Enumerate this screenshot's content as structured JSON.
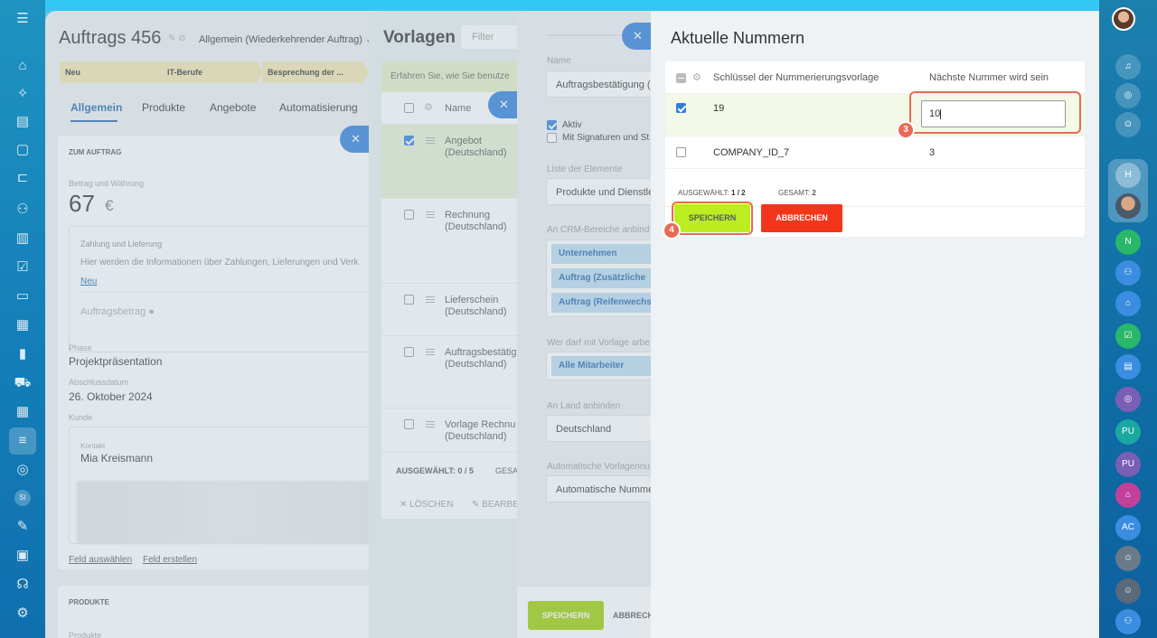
{
  "deal": {
    "title": "Auftrags 456",
    "type": "Allgemein (Wiederkehrender Auftrag)",
    "stages": [
      "Neu",
      "IT-Berufe",
      "Besprechung der ..."
    ],
    "tabs": [
      "Allgemein",
      "Produkte",
      "Angebote",
      "Automatisierung"
    ],
    "section_order": "ZUM AUFTRAG",
    "amount_label": "Betrag und Währung",
    "amount_value": "67",
    "currency": "€",
    "payment_label": "Zahlung und Lieferung",
    "payment_text": "Hier werden die Informationen über Zahlungen, Lieferungen und Verk",
    "payment_link": "Neu",
    "order_amount_label": "Auftragsbetrag",
    "phase_label": "Phase",
    "phase_value": "Projektpräsentation",
    "close_date_label": "Abschlussdatum",
    "close_date_value": "26. Oktober 2024",
    "customer_label": "Kunde",
    "contact_label": "Kontakt",
    "contact_value": "Mia Kreismann",
    "field_select": "Feld auswählen",
    "field_create": "Feld erstellen",
    "section_products": "PRODUKTE",
    "products_label": "Produkte"
  },
  "templates": {
    "title": "Vorlagen",
    "filter_placeholder": "Filter",
    "hint": "Erfahren Sie, wie Sie benutze",
    "col_name": "Name",
    "rows": [
      {
        "name": "Angebot (Deutschland)",
        "checked": true
      },
      {
        "name": "Rechnung (Deutschland)",
        "checked": false
      },
      {
        "name": "Lieferschein (Deutschland)",
        "checked": false
      },
      {
        "name": "Auftragsbestätig (Deutschland)",
        "checked": false
      },
      {
        "name": "Vorlage Rechnu (Deutschland)",
        "checked": false
      }
    ],
    "selected": "AUSGEWÄHLT: 0 / 5",
    "total": "GESA",
    "delete": "LÖSCHEN",
    "edit": "BEARBE"
  },
  "template_form": {
    "name_label": "Name",
    "name_value": "Auftragsbestätigung (",
    "active": "Aktiv",
    "signatures": "Mit Signaturen und St",
    "elements_label": "Liste der Elemente",
    "elements_value": "Produkte und Dienstle",
    "crm_label": "An CRM-Bereiche anbind",
    "crm_tags": [
      "Unternehmen",
      "Auftrag (Zusätzliche",
      "Auftrag (Reifenwechs"
    ],
    "who_label": "Wer darf mit Vorlage arbe",
    "who_tag": "Alle Mitarbeiter",
    "country_label": "An Land anbinden",
    "country_value": "Deutschland",
    "auto_label": "Automatische Vorlagennu",
    "auto_value": "Automatische Numme",
    "save": "SPEICHERN",
    "cancel": "ABBRECH"
  },
  "modal": {
    "title": "Aktuelle Nummern",
    "col_key": "Schlüssel der Nummerierungsvorlage",
    "col_next": "Nächste Nummer wird sein",
    "rows": [
      {
        "key": "19",
        "next": "10",
        "checked": true
      },
      {
        "key": "COMPANY_ID_7",
        "next": "3",
        "checked": false
      }
    ],
    "selected_label": "AUSGEWÄHLT:",
    "selected_value": "1 / 2",
    "total_label": "GESAMT:",
    "total_value": "2",
    "save": "SPEICHERN",
    "cancel": "ABBRECHEN",
    "step_input": "3",
    "step_save": "4"
  },
  "right_sidebar": {
    "initials": [
      "H",
      "N",
      "PU",
      "PU",
      "AC"
    ]
  },
  "left_sidebar": {
    "si": "SI"
  },
  "colors": {
    "accent_blue": "#2d7fde",
    "save_green": "#bbed21",
    "cancel_red": "#f1361b",
    "highlight": "#e86a55"
  }
}
